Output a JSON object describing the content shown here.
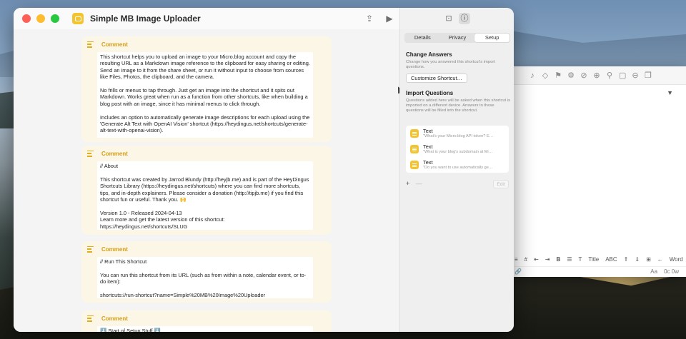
{
  "app": {
    "title": "Simple MB Image Uploader"
  },
  "comments": [
    {
      "title": "Comment",
      "text": "This shortcut helps you to upload an image to your Micro.blog account and copy the resulting URL as a Markdown image reference to the clipboard for easy sharing or editing. Send an image to it from the share sheet, or run it without input to choose from sources like Files, Photos, the clipboard, and the camera.\n\nNo frills or menus to tap through. Just get an image into the shortcut and it spits out Markdown. Works great when run as a function from other shortcuts, like when building a blog post with an image, since it has minimal menus to click through.\n\nIncludes an option to automatically generate image descriptions for each upload using the 'Generate Alt Text with OpenAI Vision' shortcut (https://heydingus.net/shortcuts/generate-alt-text-with-openai-vision)."
    },
    {
      "title": "Comment",
      "text": "// About\n\nThis shortcut was created by Jarrod Blundy (http://heyjb.me) and is part of the HeyDingus Shortcuts Library (https://heydingus.net/shortcuts) where you can find more shortcuts, tips, and in-depth explainers. Please consider a donation (http://tipjb.me) if you find this shortcut fun or useful. Thank you. 🙌\n\nVersion 1.0 - Released 2024-04-13\nLearn more and get the latest version of this shortcut: https://heydingus.net/shortcuts/SLUG"
    },
    {
      "title": "Comment",
      "text": "// Run This Shortcut\n\nYou can run this shortcut from its URL (such as from within a note, calendar event, or to-do item):\n\nshortcuts://run-shortcut?name=Simple%20MB%20Image%20Uploader"
    },
    {
      "title": "Comment",
      "text": "⬇️ Start of Setup Stuff ⬇️"
    }
  ],
  "panel": {
    "tabs": [
      "Details",
      "Privacy",
      "Setup"
    ],
    "active_tab": "Setup",
    "change_answers": {
      "heading": "Change Answers",
      "description": "Change how you answered this shortcut's import questions.",
      "button": "Customize Shortcut…"
    },
    "import_questions": {
      "heading": "Import Questions",
      "description": "Questions added here will be asked when this shortcut is imported on a different device. Answers to these questions will be filled into the shortcut.",
      "items": [
        {
          "title": "Text",
          "desc": "\"What's your Micro.blog API token? E…"
        },
        {
          "title": "Text",
          "desc": "\"What is your blog's subdomain at Mi…"
        },
        {
          "title": "Text",
          "desc": "\"Do you want to use automatically ge…"
        }
      ],
      "add": "+",
      "remove": "—",
      "edit": "Edit"
    }
  },
  "background_window": {
    "toolbar_items": [
      "Title",
      "ABC",
      "Word"
    ],
    "bottom": [
      "Aa",
      "0c 0w"
    ]
  },
  "colors": {
    "accent": "#f4c430",
    "comment_header": "#d5a019",
    "comment_bg": "#fcf6e6"
  }
}
